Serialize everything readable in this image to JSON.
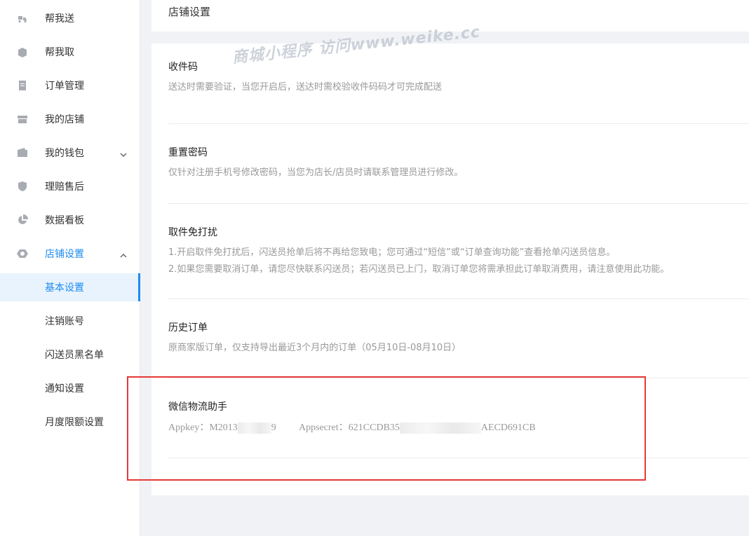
{
  "sidebar": {
    "items": [
      {
        "label": "帮我送",
        "icon": "scooter-icon"
      },
      {
        "label": "帮我取",
        "icon": "package-icon"
      },
      {
        "label": "订单管理",
        "icon": "order-icon"
      },
      {
        "label": "我的店铺",
        "icon": "store-icon"
      },
      {
        "label": "我的钱包",
        "icon": "wallet-icon"
      },
      {
        "label": "理赔售后",
        "icon": "shield-icon"
      },
      {
        "label": "数据看板",
        "icon": "pie-chart-icon"
      },
      {
        "label": "店铺设置",
        "icon": "settings-icon"
      }
    ],
    "sub_items": [
      "基本设置",
      "注销账号",
      "闪送员黑名单",
      "通知设置",
      "月度限额设置"
    ],
    "active_sub": "基本设置"
  },
  "header": {
    "title": "店铺设置"
  },
  "sections": [
    {
      "title": "收件码",
      "desc": [
        "送达时需要验证，当您开启后，送达时需校验收件码码才可完成配送"
      ]
    },
    {
      "title": "重置密码",
      "desc": [
        "仅针对注册手机号修改密码，当您为店长/店员时请联系管理员进行修改。"
      ]
    },
    {
      "title": "取件免打扰",
      "desc": [
        "1.开启取件免打扰后，闪送员抢单后将不再给您致电；您可通过“短信”或“订单查询功能”查看抢单闪送员信息。",
        "2.如果您需要取消订单，请您尽快联系闪送员；若闪送员已上门，取消订单您将需承担此订单取消费用，请注意使用此功能。"
      ]
    },
    {
      "title": "历史订单",
      "desc": [
        "原商家版订单，仅支持导出最近3个月内的订单（05月10日-08月10日）"
      ]
    }
  ],
  "wechat": {
    "title": "微信物流助手",
    "appkey_label": "Appkey：",
    "appkey_start": "M2013",
    "appkey_end": "9",
    "appsecret_label": "Appsecret：",
    "appsecret_start": "621CCDB35",
    "appsecret_end": "AECD691CB"
  },
  "watermark": "商城小程序 访问www.weike.cc",
  "colors": {
    "accent": "#1e8cf0",
    "highlight_box": "#e53935"
  }
}
